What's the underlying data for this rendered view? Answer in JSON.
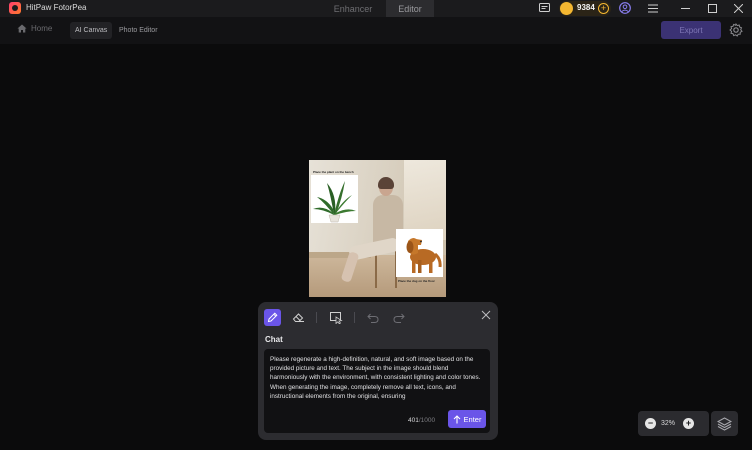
{
  "app": {
    "title": "HitPaw FotorPea"
  },
  "mode_tabs": [
    {
      "label": "Enhancer",
      "active": false
    },
    {
      "label": "Editor",
      "active": true
    }
  ],
  "credits": {
    "count": "9384",
    "badge_color": "#f4b731"
  },
  "toolbar": {
    "home_label": "Home",
    "tabs": [
      {
        "label": "AI Canvas",
        "active": true
      },
      {
        "label": "Photo Editor",
        "active": false
      }
    ],
    "export_label": "Export"
  },
  "canvas": {
    "captions": {
      "plant": "Place the plant on the bench",
      "dog": "Place the dog on the floor"
    }
  },
  "chat": {
    "heading": "Chat",
    "prompt": "Please regenerate a high-definition, natural, and soft image based on the provided picture and text. The subject in the image should blend harmoniously with the environment, with consistent lighting and color tones. When generating the image, completely remove all text, icons, and instructional elements from the original, ensuring",
    "char_count": "401",
    "char_max": "/1000",
    "enter_label": "Enter"
  },
  "zoom": {
    "value": "32%"
  },
  "colors": {
    "accent": "#6a55e8",
    "background": "#0b0b0c",
    "panel": "#2c2c30"
  }
}
